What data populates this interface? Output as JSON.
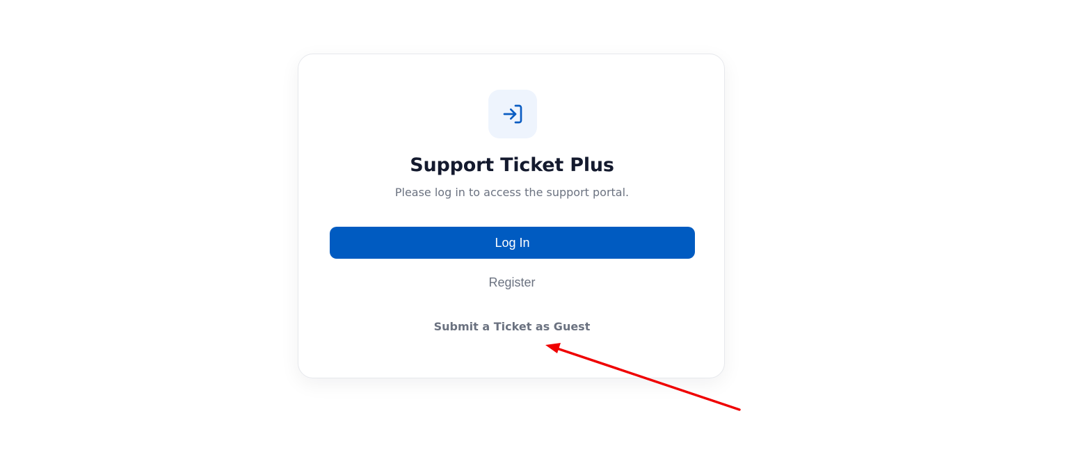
{
  "card": {
    "icon": "login-arrow-icon",
    "title": "Support Ticket Plus",
    "subtitle": "Please log in to access the support portal.",
    "login_label": "Log In",
    "register_label": "Register",
    "guest_label": "Submit a Ticket as Guest"
  },
  "annotation": {
    "icon": "red-arrow-annotation",
    "color": "#ef0000"
  },
  "colors": {
    "primary": "#005bc1",
    "title": "#141a2e",
    "muted": "#6b7280",
    "icon_tile_bg": "#eef4fd"
  }
}
